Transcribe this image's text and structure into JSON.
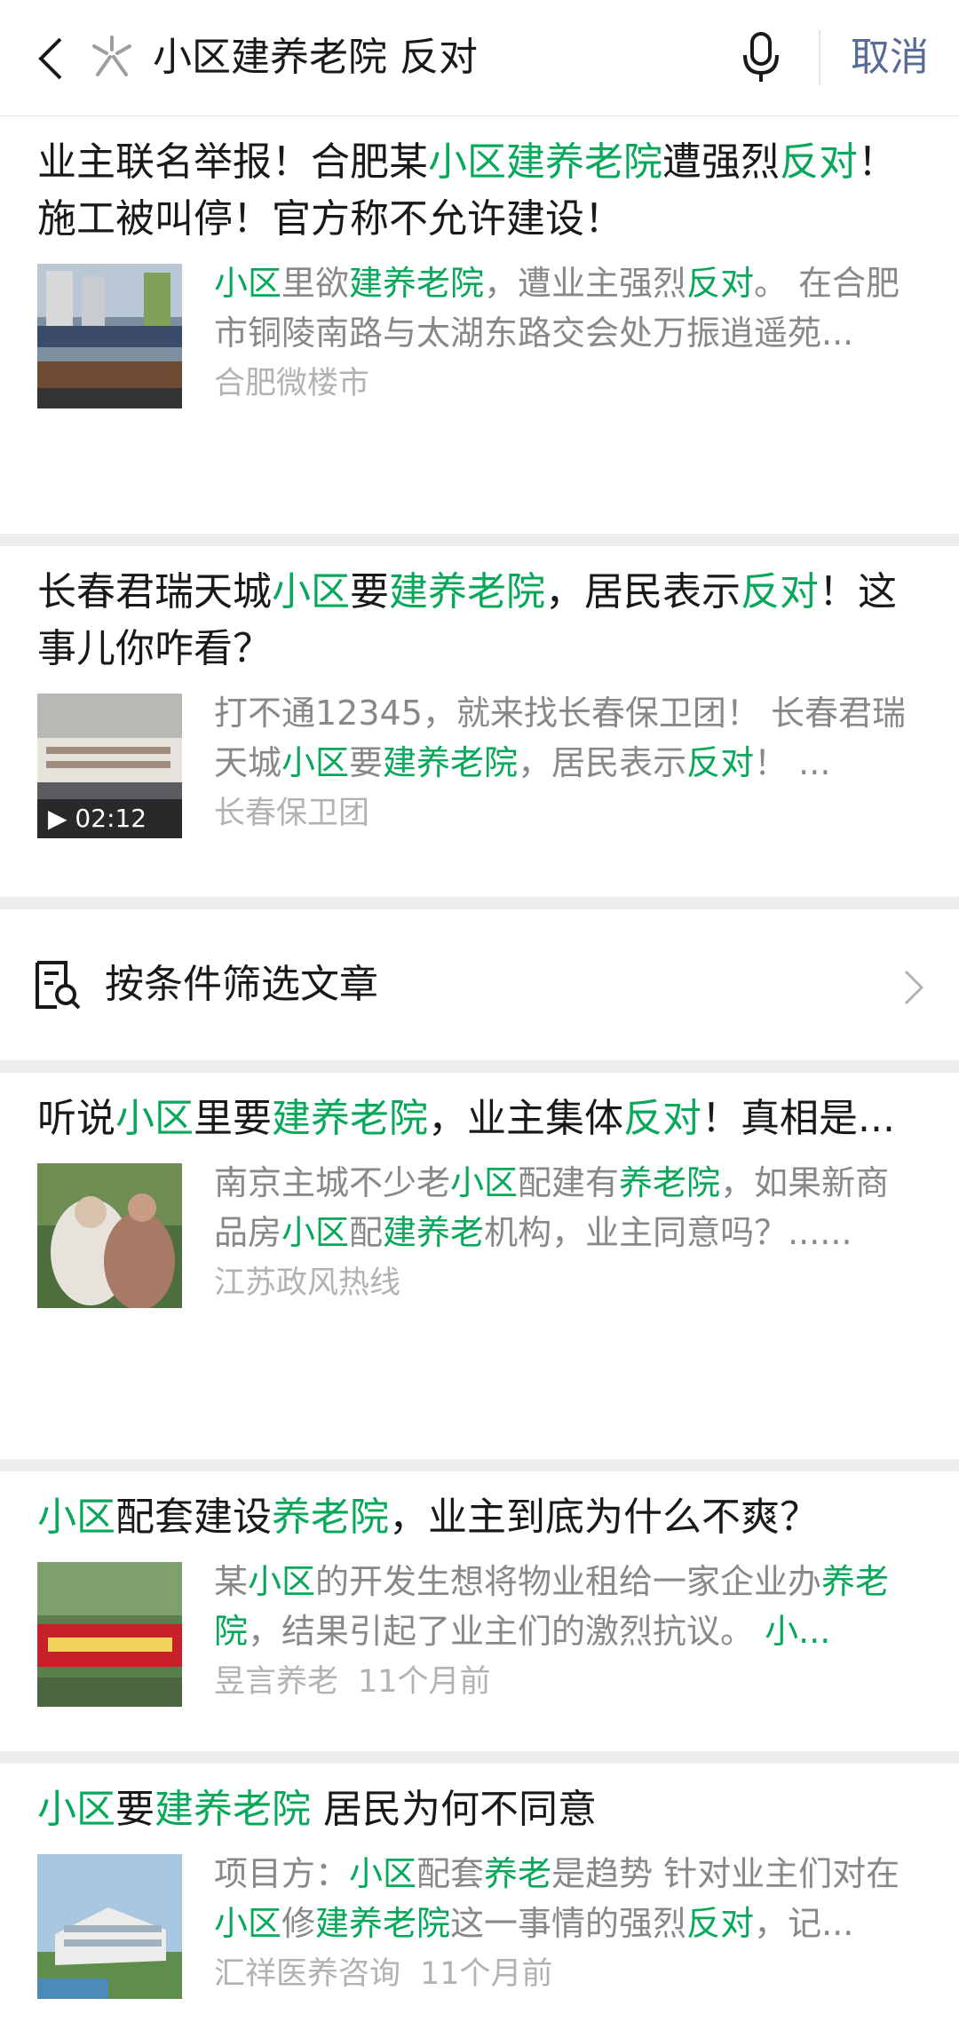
{
  "header": {
    "query": "小区建养老院 反对",
    "cancel_label": "取消"
  },
  "filter": {
    "label": "按条件筛选文章"
  },
  "colors": {
    "highlight": "#07a85a",
    "link": "#576b95",
    "meta": "#b2b2b2"
  },
  "articles": [
    {
      "title": [
        {
          "t": "业主联名举报！合肥某"
        },
        {
          "t": "小区建养老院",
          "hl": true
        },
        {
          "t": "遭强烈"
        },
        {
          "t": "反对",
          "hl": true
        },
        {
          "t": "！施工被叫停！官方称不允许建设！"
        }
      ],
      "snippet": [
        {
          "t": "小区",
          "hl": true
        },
        {
          "t": "里欲"
        },
        {
          "t": "建养老院",
          "hl": true
        },
        {
          "t": "，遭业主强烈"
        },
        {
          "t": "反对",
          "hl": true
        },
        {
          "t": "。 在合肥市铜陵南路与太湖东路交会处万振逍遥苑..."
        }
      ],
      "source": "合肥微楼市",
      "time": "",
      "duration": ""
    },
    {
      "title": [
        {
          "t": "长春君瑞天城"
        },
        {
          "t": "小区",
          "hl": true
        },
        {
          "t": "要"
        },
        {
          "t": "建养老院",
          "hl": true
        },
        {
          "t": "，居民表示"
        },
        {
          "t": "反对",
          "hl": true
        },
        {
          "t": "！这事儿你咋看？"
        }
      ],
      "snippet": [
        {
          "t": "打不通12345，就来找长春保卫团！ 长春君瑞天城"
        },
        {
          "t": "小区",
          "hl": true
        },
        {
          "t": "要"
        },
        {
          "t": "建养老院",
          "hl": true
        },
        {
          "t": "，居民表示"
        },
        {
          "t": "反对",
          "hl": true
        },
        {
          "t": "！ ..."
        }
      ],
      "source": "长春保卫团",
      "time": "",
      "duration": "▶ 02:12"
    },
    {
      "title": [
        {
          "t": "听说"
        },
        {
          "t": "小区",
          "hl": true
        },
        {
          "t": "里要"
        },
        {
          "t": "建养老院",
          "hl": true
        },
        {
          "t": "，业主集体"
        },
        {
          "t": "反对",
          "hl": true
        },
        {
          "t": "！真相是..."
        }
      ],
      "snippet": [
        {
          "t": "南京主城不少老"
        },
        {
          "t": "小区",
          "hl": true
        },
        {
          "t": "配建有"
        },
        {
          "t": "养老院",
          "hl": true
        },
        {
          "t": "，如果新商品房"
        },
        {
          "t": "小区",
          "hl": true
        },
        {
          "t": "配"
        },
        {
          "t": "建养老",
          "hl": true
        },
        {
          "t": "机构，业主同意吗？......"
        }
      ],
      "source": "江苏政风热线",
      "time": "",
      "duration": ""
    },
    {
      "title": [
        {
          "t": "小区",
          "hl": true
        },
        {
          "t": "配套建设"
        },
        {
          "t": "养老院",
          "hl": true
        },
        {
          "t": "，业主到底为什么不爽？"
        }
      ],
      "snippet": [
        {
          "t": "某"
        },
        {
          "t": "小区",
          "hl": true
        },
        {
          "t": "的开发生想将物业租给一家企业办"
        },
        {
          "t": "养老院",
          "hl": true
        },
        {
          "t": "，结果引起了业主们的激烈抗议。 "
        },
        {
          "t": "小...",
          "hl": true
        }
      ],
      "source": "昱言养老",
      "time": "11个月前",
      "duration": ""
    },
    {
      "title": [
        {
          "t": "小区",
          "hl": true
        },
        {
          "t": "要"
        },
        {
          "t": "建养老院",
          "hl": true
        },
        {
          "t": " 居民为何不同意"
        }
      ],
      "snippet": [
        {
          "t": "项目方："
        },
        {
          "t": "小区",
          "hl": true
        },
        {
          "t": "配套"
        },
        {
          "t": "养老",
          "hl": true
        },
        {
          "t": "是趋势 针对业主们对在"
        },
        {
          "t": "小区",
          "hl": true
        },
        {
          "t": "修"
        },
        {
          "t": "建养老院",
          "hl": true
        },
        {
          "t": "这一事情的强烈"
        },
        {
          "t": "反对",
          "hl": true
        },
        {
          "t": "，记..."
        }
      ],
      "source": "汇祥医养咨询",
      "time": "11个月前",
      "duration": ""
    }
  ]
}
